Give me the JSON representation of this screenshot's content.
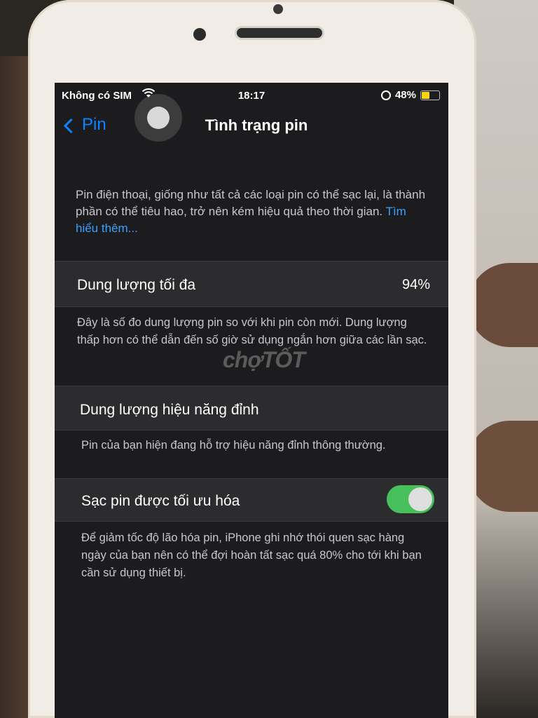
{
  "status_bar": {
    "carrier": "Không có SIM",
    "time": "18:17",
    "battery_text": "48%",
    "battery_level": 0.48,
    "battery_color": "#ffd60a"
  },
  "nav": {
    "back_label": "Pin",
    "title": "Tình trạng pin"
  },
  "intro": {
    "text": "Pin điện thoại, giống như tất cả các loại pin có thể sạc lại, là thành phần có thể tiêu hao, trở nên kém hiệu quả theo thời gian.",
    "link_text": "Tìm hiểu thêm..."
  },
  "max_capacity": {
    "label": "Dung lượng tối đa",
    "value": "94%",
    "description": "Đây là số đo dung lượng pin so với khi pin còn mới. Dung lượng thấp hơn có thể dẫn đến số giờ sử dụng ngắn hơn giữa các lần sạc."
  },
  "peak_performance": {
    "label": "Dung lượng hiệu năng đỉnh",
    "description": "Pin của bạn hiện đang hỗ trợ hiệu năng đỉnh thông thường."
  },
  "optimized_charging": {
    "label": "Sạc pin được tối ưu hóa",
    "enabled": true,
    "toggle_color": "#4cd964",
    "description": "Để giảm tốc độ lão hóa pin, iPhone ghi nhớ thói quen sạc hàng ngày của bạn nên có thể đợi hoàn tất sạc quá 80% cho tới khi bạn cần sử dụng thiết bị."
  },
  "watermark": "chợTỐT",
  "colors": {
    "accent": "#0a84ff",
    "background": "#1c1c1e",
    "cell": "#2c2c2e"
  }
}
